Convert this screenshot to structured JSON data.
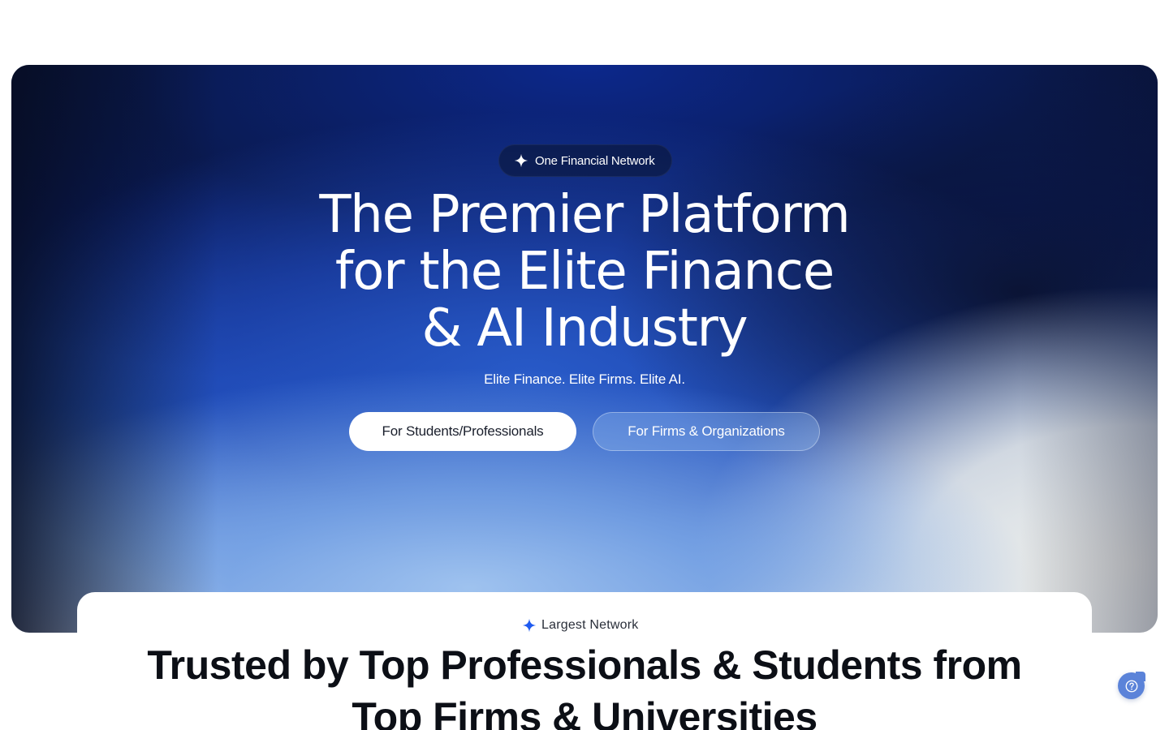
{
  "hero": {
    "pill_label": "One Financial Network",
    "headline_lines": [
      "The Premier Platform",
      "for the Elite Finance",
      "& AI Industry"
    ],
    "tagline": "Elite Finance. Elite Firms. Elite AI.",
    "primary_button_label": "For Students/Professionals",
    "secondary_button_label": "For Firms & Organizations"
  },
  "network_section": {
    "badge_label": "Largest Network",
    "heading_lines": [
      "Trusted by Top Professionals & Students from",
      "Top Firms & Universities"
    ]
  },
  "icons": {
    "pill_icon": "sparkle-icon",
    "badge_icon": "sparkle-icon",
    "help_icon": "question-circle-icon"
  },
  "colors": {
    "sparkle_blue": "#1f5bf0",
    "help_button": "#5b83d9",
    "heading_text": "#0c0f16"
  }
}
